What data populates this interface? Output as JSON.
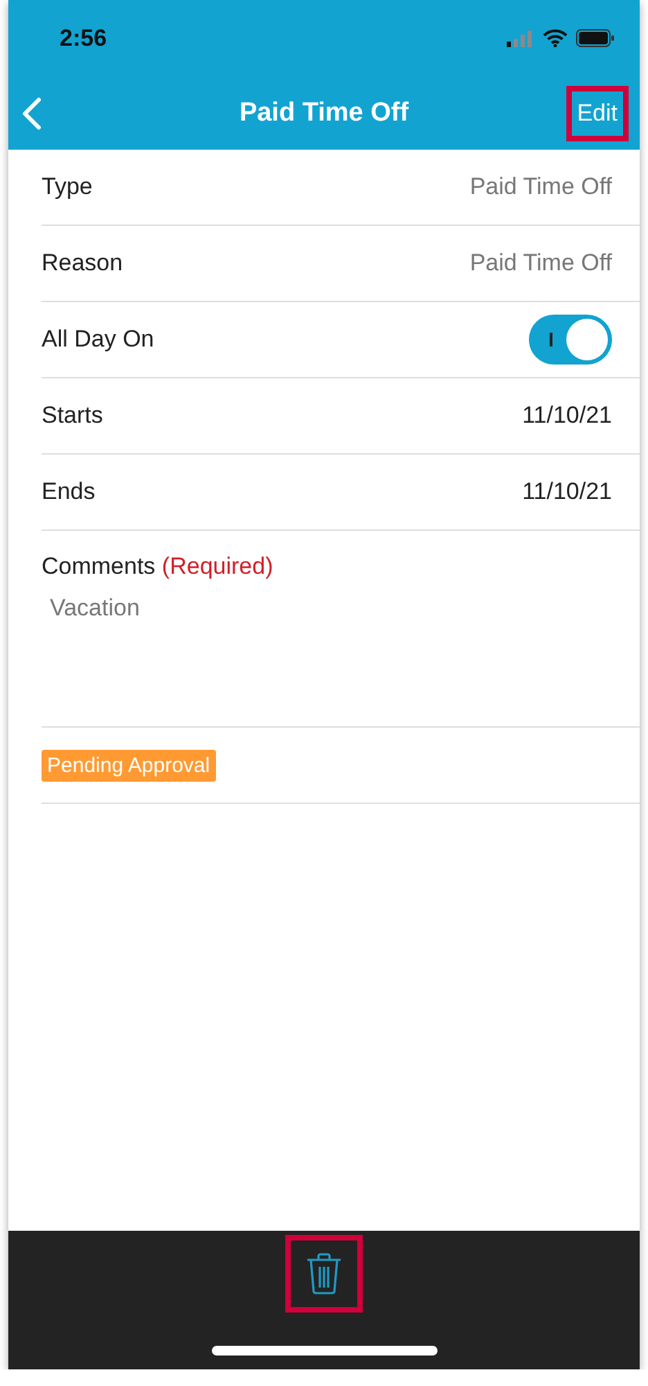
{
  "status_bar": {
    "time": "2:56"
  },
  "nav": {
    "title": "Paid Time Off",
    "action": {
      "label": "Edit",
      "highlighted": true
    }
  },
  "fields": [
    {
      "kind": "value",
      "label": "Type",
      "value": "Paid Time Off"
    },
    {
      "kind": "value",
      "label": "Reason",
      "value": "Paid Time Off"
    },
    {
      "kind": "toggle",
      "label": "All Day On",
      "on": true
    },
    {
      "kind": "value",
      "label": "Starts",
      "value": "11/10/21"
    },
    {
      "kind": "value",
      "label": "Ends",
      "value": "11/10/21"
    }
  ],
  "comments": {
    "label": "Comments",
    "required": "(Required)",
    "value": "Vacation"
  },
  "status_badge": "Pending Approval",
  "toolbar": {
    "delete": {
      "highlighted": true
    }
  }
}
